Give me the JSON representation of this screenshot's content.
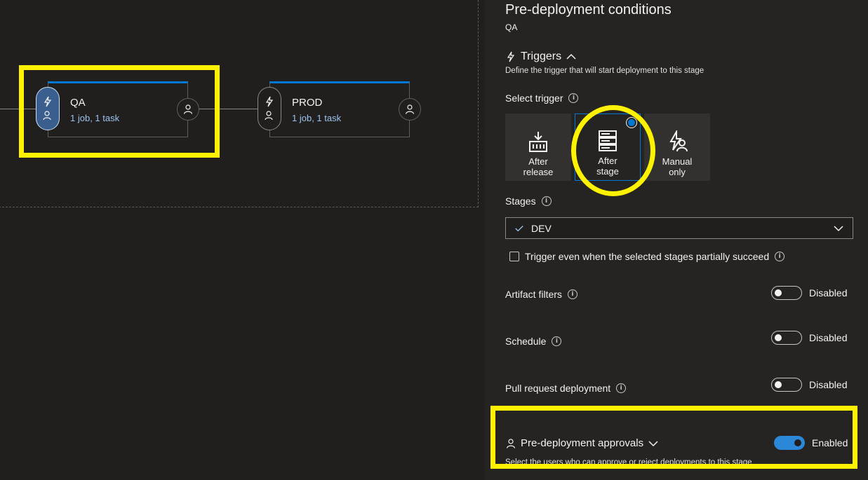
{
  "pipeline": {
    "stages": [
      {
        "name": "QA",
        "summary": "1 job, 1 task"
      },
      {
        "name": "PROD",
        "summary": "1 job, 1 task"
      }
    ]
  },
  "panel": {
    "title": "Pre-deployment conditions",
    "stage_name": "QA",
    "triggers": {
      "heading": "Triggers",
      "description": "Define the trigger that will start deployment to this stage",
      "select_label": "Select trigger",
      "options": [
        {
          "line1": "After",
          "line2": "release",
          "icon": "after-release-icon"
        },
        {
          "line1": "After",
          "line2": "stage",
          "icon": "after-stage-icon",
          "selected": true
        },
        {
          "line1": "Manual",
          "line2": "only",
          "icon": "manual-only-icon"
        }
      ],
      "stages_label": "Stages",
      "stages_value": "DEV",
      "partial_checkbox_label": "Trigger even when the selected stages partially succeed",
      "partial_checked": false
    },
    "artifact_filters": {
      "label": "Artifact filters",
      "state": "Disabled"
    },
    "schedule": {
      "label": "Schedule",
      "state": "Disabled"
    },
    "pull_request": {
      "label": "Pull request deployment",
      "state": "Disabled"
    },
    "approvals": {
      "heading": "Pre-deployment approvals",
      "state": "Enabled",
      "description": "Select the users who can approve or reject deployments to this stage"
    }
  },
  "colors": {
    "accent": "#0078d4",
    "highlight": "#fff200"
  }
}
